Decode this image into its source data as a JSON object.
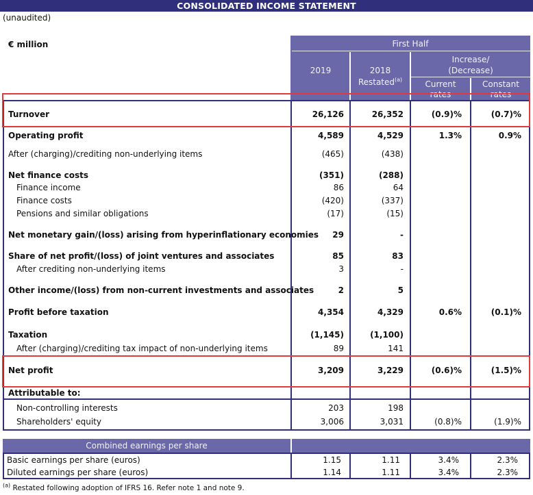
{
  "title": "CONSOLIDATED INCOME STATEMENT",
  "subtitle": "(unaudited)",
  "unit_label": "€ million",
  "header": {
    "first_half": "First Half",
    "col_2019": "2019",
    "col_2018_line1": "2018",
    "col_2018_line2": "Restated",
    "col_2018_sup": "(a)",
    "increase_line1": "Increase/",
    "increase_line2": "(Decrease)",
    "current_line1": "Current",
    "current_line2": "rates",
    "constant_line1": "Constant",
    "constant_line2": "rates"
  },
  "rows": [
    {
      "label": "Turnover",
      "bold": true,
      "y2019": "26,126",
      "y2018": "26,352",
      "current": "(0.9)%",
      "constant": "(0.7)%"
    },
    {
      "label": "Operating profit",
      "bold": true,
      "y2019": "4,589",
      "y2018": "4,529",
      "current": "1.3%",
      "constant": "0.9%"
    },
    {
      "label": "After (charging)/crediting non-underlying items",
      "bold": false,
      "y2019": "(465)",
      "y2018": "(438)",
      "current": "",
      "constant": ""
    },
    {
      "label": "Net finance costs",
      "bold": true,
      "y2019": "(351)",
      "y2018": "(288)",
      "current": "",
      "constant": ""
    },
    {
      "label": "Finance income",
      "bold": false,
      "y2019": "86",
      "y2018": "64",
      "current": "",
      "constant": ""
    },
    {
      "label": "Finance costs",
      "bold": false,
      "y2019": "(420)",
      "y2018": "(337)",
      "current": "",
      "constant": ""
    },
    {
      "label": "Pensions and similar obligations",
      "bold": false,
      "y2019": "(17)",
      "y2018": "(15)",
      "current": "",
      "constant": ""
    },
    {
      "label": "Net monetary gain/(loss) arising from hyperinflationary economies",
      "bold": true,
      "y2019": "29",
      "y2018": "-",
      "current": "",
      "constant": ""
    },
    {
      "label": "Share of net profit/(loss) of joint ventures and associates",
      "bold": true,
      "y2019": "85",
      "y2018": "83",
      "current": "",
      "constant": ""
    },
    {
      "label": "After crediting non-underlying items",
      "bold": false,
      "y2019": "3",
      "y2018": "-",
      "current": "",
      "constant": ""
    },
    {
      "label": "Other income/(loss) from non-current investments and associates",
      "bold": true,
      "y2019": "2",
      "y2018": "5",
      "current": "",
      "constant": ""
    },
    {
      "label": "Profit before taxation",
      "bold": true,
      "y2019": "4,354",
      "y2018": "4,329",
      "current": "0.6%",
      "constant": "(0.1)%"
    },
    {
      "label": "Taxation",
      "bold": true,
      "y2019": "(1,145)",
      "y2018": "(1,100)",
      "current": "",
      "constant": ""
    },
    {
      "label": "After (charging)/crediting tax impact of non-underlying items",
      "bold": false,
      "y2019": "89",
      "y2018": "141",
      "current": "",
      "constant": ""
    },
    {
      "label": "Net profit",
      "bold": true,
      "y2019": "3,209",
      "y2018": "3,229",
      "current": "(0.6)%",
      "constant": "(1.5)%"
    },
    {
      "label": "Attributable to:",
      "bold": true,
      "y2019": "",
      "y2018": "",
      "current": "",
      "constant": ""
    },
    {
      "label": "Non-controlling interests",
      "bold": false,
      "y2019": "203",
      "y2018": "198",
      "current": "",
      "constant": ""
    },
    {
      "label": "Shareholders' equity",
      "bold": false,
      "y2019": "3,006",
      "y2018": "3,031",
      "current": "(0.8)%",
      "constant": "(1.9)%"
    }
  ],
  "eps": {
    "header": "Combined earnings per share",
    "rows": [
      {
        "label": "Basic earnings per share (euros)",
        "y2019": "1.15",
        "y2018": "1.11",
        "current": "3.4%",
        "constant": "2.3%"
      },
      {
        "label": "Diluted earnings per share (euros)",
        "y2019": "1.14",
        "y2018": "1.11",
        "current": "3.4%",
        "constant": "2.3%"
      }
    ]
  },
  "footnote_marker": "(a)",
  "footnote": "Restated following adoption of IFRS 16. Refer note 1 and note 9.",
  "colors": {
    "navy": "#2f2f7c",
    "header_purple": "#6a68a8",
    "highlight_red": "#e23a3a"
  }
}
